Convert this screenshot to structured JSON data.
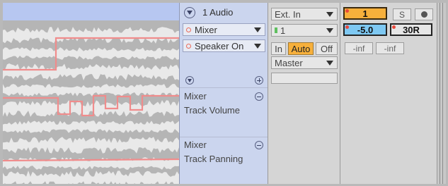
{
  "track": {
    "name": "1 Audio",
    "device_chooser": "Mixer",
    "parameter_chooser": "Speaker On"
  },
  "automation_lanes": [
    {
      "device": "Mixer",
      "parameter": "Track Volume"
    },
    {
      "device": "Mixer",
      "parameter": "Track Panning"
    }
  ],
  "io": {
    "audio_from": "Ext. In",
    "input_channel": "1",
    "monitor": {
      "options": [
        "In",
        "Auto",
        "Off"
      ],
      "selected": "Auto"
    },
    "audio_to": "Master"
  },
  "mixer": {
    "track_activator": "1",
    "solo_label": "S",
    "volume": "-5.0",
    "pan": "30R",
    "peak_left": "-inf",
    "peak_right": "-inf"
  },
  "colors": {
    "automation_line": "#f08c8c",
    "lane_header": "#b7c7f1",
    "active_orange": "#f7b03b",
    "selected_blue": "#7ec8f2"
  },
  "icons": [
    "fold-triangle-icon",
    "unfold-lanes-icon",
    "add-lane-icon",
    "remove-lane-icon",
    "record-arm-icon"
  ]
}
